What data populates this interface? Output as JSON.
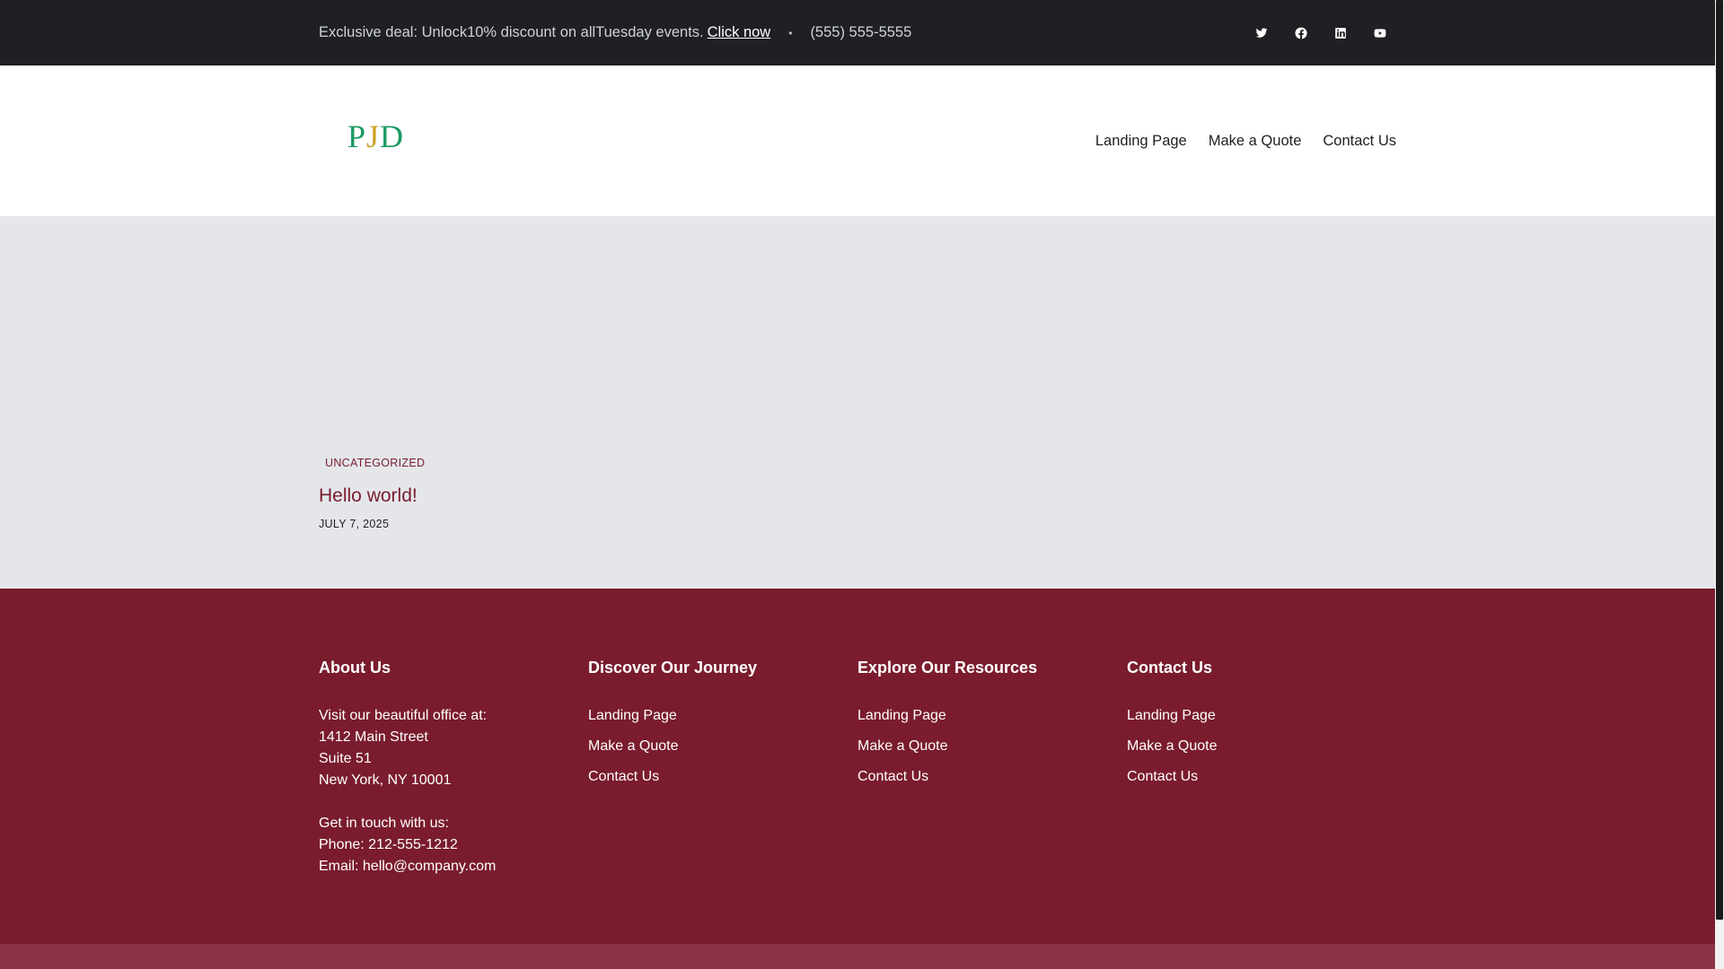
{
  "topbar": {
    "deal_text": "Exclusive deal: Unlock10% discount on allTuesday events.",
    "deal_link": "Click now",
    "separator": "•",
    "phone": "(555) 555-5555",
    "socials": [
      "twitter-icon",
      "facebook-icon",
      "linkedin-icon",
      "youtube-icon"
    ]
  },
  "header": {
    "logo": {
      "p": "P",
      "j": "J",
      "d": "D"
    },
    "nav": [
      "Landing Page",
      "Make a Quote",
      "Contact Us"
    ]
  },
  "post": {
    "category": "UNCATEGORIZED",
    "title": "Hello world!",
    "date": "JULY 7, 2025"
  },
  "footer": {
    "about": {
      "heading": "About Us",
      "lines1": [
        "Visit our beautiful office at:",
        "1412 Main Street",
        "Suite 51",
        "New York, NY 10001"
      ],
      "lines2": [
        "Get in touch with us:",
        "Phone: 212-555-1212",
        "Email: hello@company.com"
      ]
    },
    "journey": {
      "heading": "Discover Our Journey",
      "links": [
        "Landing Page",
        "Make a Quote",
        "Contact Us"
      ]
    },
    "resources": {
      "heading": "Explore Our Resources",
      "links": [
        "Landing Page",
        "Make a Quote",
        "Contact Us"
      ]
    },
    "contact": {
      "heading": "Contact Us",
      "links": [
        "Landing Page",
        "Make a Quote",
        "Contact Us"
      ]
    }
  },
  "colors": {
    "topbar_bg": "#1f2024",
    "brand": "#7a1c2e",
    "hero_bg": "#e4e6ea",
    "logo_green": "#1a9a63",
    "logo_gold": "#c9a227"
  }
}
